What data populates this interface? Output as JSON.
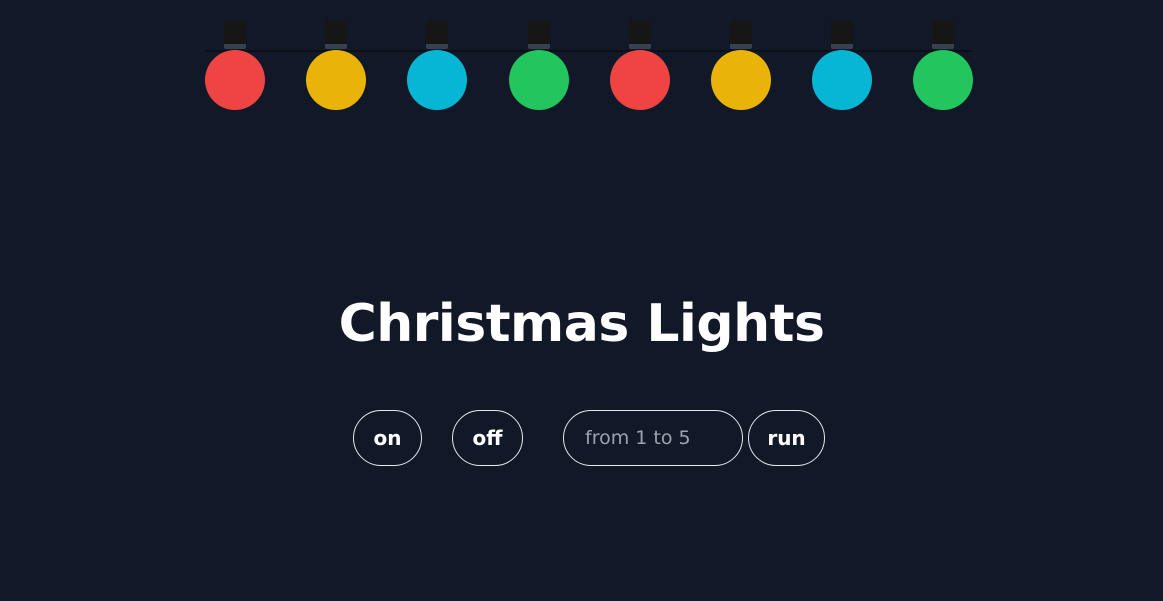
{
  "page": {
    "title": "Christmas Lights",
    "background_color": "#111827"
  },
  "lights": {
    "bulbs": [
      {
        "color": "#ef4444"
      },
      {
        "color": "#eab308"
      },
      {
        "color": "#06b6d4"
      },
      {
        "color": "#22c55e"
      },
      {
        "color": "#ef4444"
      },
      {
        "color": "#eab308"
      },
      {
        "color": "#06b6d4"
      },
      {
        "color": "#22c55e"
      }
    ],
    "cap_color": "#161616",
    "wire_color": "#0b0f16"
  },
  "controls": {
    "on_label": "on",
    "off_label": "off",
    "speed_input": {
      "value": "",
      "placeholder": "from 1 to 5"
    },
    "run_label": "run"
  }
}
